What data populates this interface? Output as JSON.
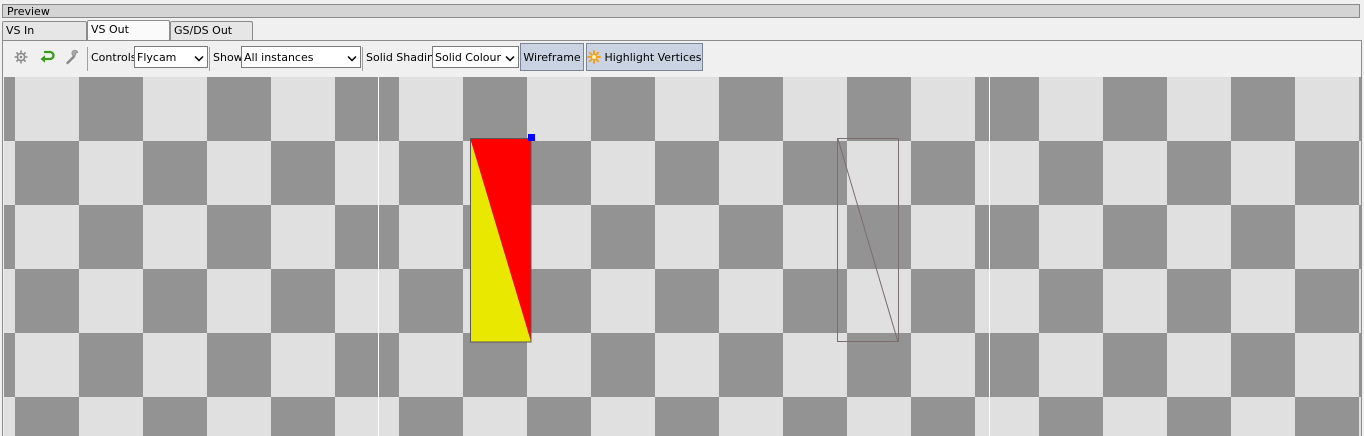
{
  "panel": {
    "title": "Preview"
  },
  "tabs": [
    {
      "label": "VS In",
      "active": false
    },
    {
      "label": "VS Out",
      "active": true
    },
    {
      "label": "GS/DS Out",
      "active": false
    }
  ],
  "toolbar": {
    "icons": [
      "gear-icon",
      "return-arrow-icon",
      "wrench-icon"
    ],
    "controls_label": "Controls",
    "controls_value": "Flycam",
    "show_label": "Show",
    "show_value": "All instances",
    "shading_label": "Solid Shading",
    "shading_value": "Solid Colour",
    "wireframe_label": "Wireframe",
    "highlight_label": "Highlight Vertices"
  },
  "viewport": {
    "checker_colors": {
      "light": "#e0e0e0",
      "dark": "#939393"
    },
    "mesh_colors": {
      "triangle_a": "#ff0000",
      "triangle_b": "#e8e800",
      "vertex_highlight": "#0000ff",
      "wireframe": "#7a6e6e",
      "guide_line": "#ffffff"
    }
  }
}
